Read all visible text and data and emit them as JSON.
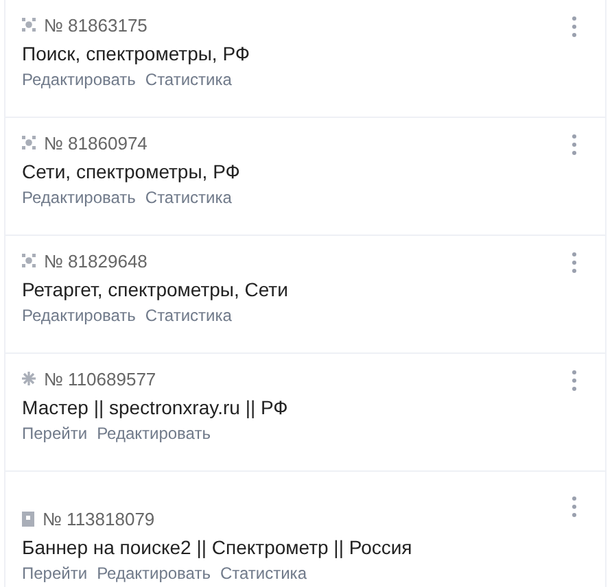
{
  "campaigns": [
    {
      "kind": "text",
      "number": "№ 81863175",
      "title": "Поиск, спектрометры, РФ",
      "links": [
        "Редактировать",
        "Статистика"
      ]
    },
    {
      "kind": "text",
      "number": "№ 81860974",
      "title": "Сети, спектрометры, РФ",
      "links": [
        "Редактировать",
        "Статистика"
      ]
    },
    {
      "kind": "text",
      "number": "№ 81829648",
      "title": "Ретаргет, спектрометры, Сети",
      "links": [
        "Редактировать",
        "Статистика"
      ]
    },
    {
      "kind": "master",
      "number": "№ 110689577",
      "title": "Мастер || spectronxray.ru || РФ",
      "links": [
        "Перейти",
        "Редактировать"
      ]
    },
    {
      "kind": "banner",
      "number": "№ 113818079",
      "title": "Баннер на поиске2 || Спектрометр || Россия",
      "links": [
        "Перейти",
        "Редактировать",
        "Статистика"
      ]
    }
  ]
}
